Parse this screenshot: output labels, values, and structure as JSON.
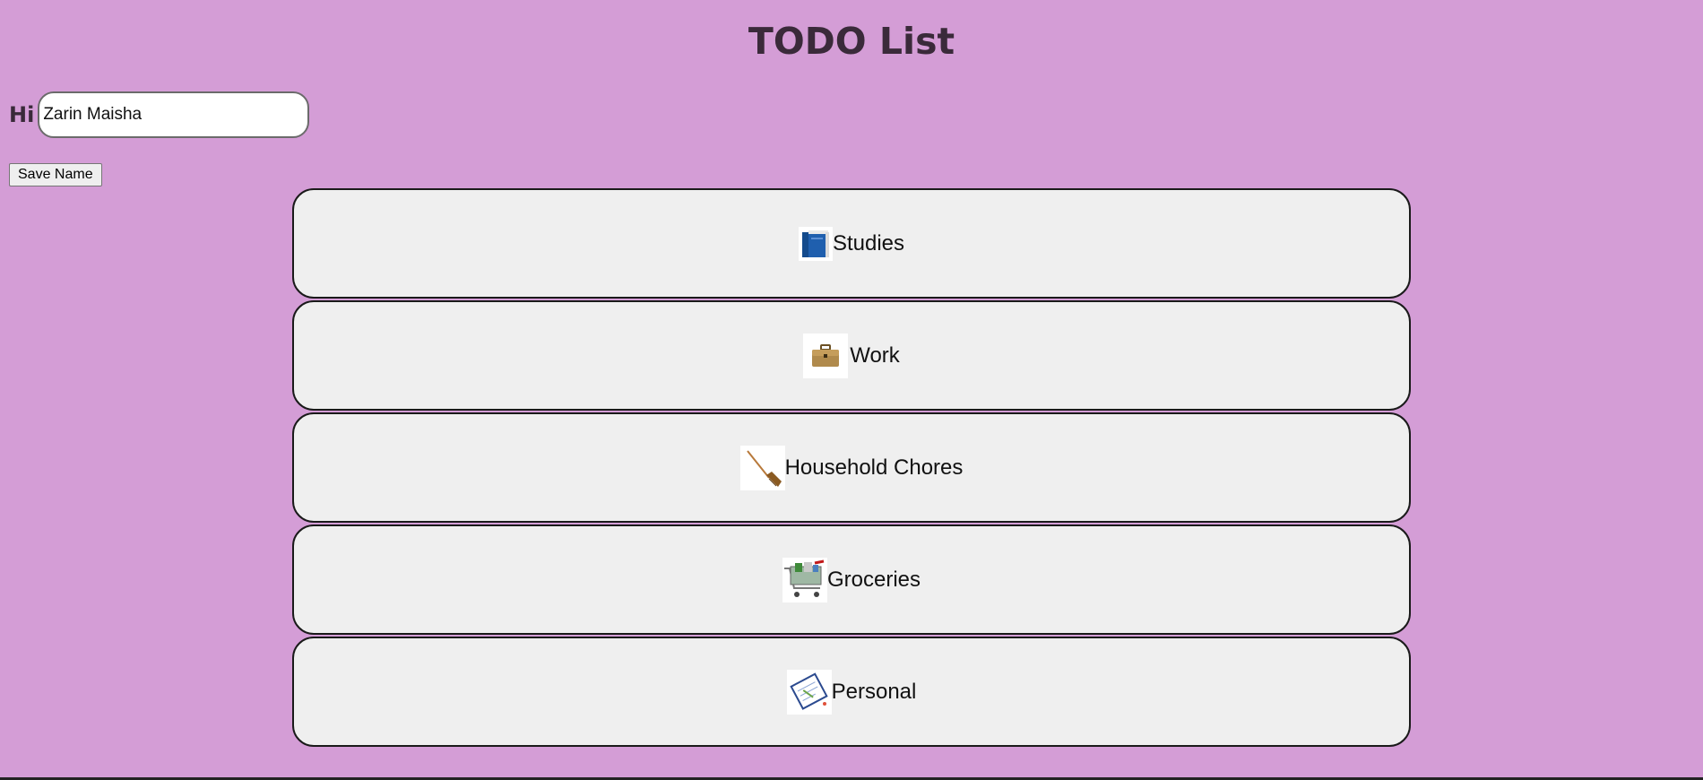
{
  "header": {
    "title": "TODO List"
  },
  "greeting": {
    "label": "Hi",
    "name_value": "Zarin Maisha",
    "save_label": "Save Name"
  },
  "categories": [
    {
      "label": "Studies",
      "icon": "book-icon"
    },
    {
      "label": "Work",
      "icon": "briefcase-icon"
    },
    {
      "label": "Household Chores",
      "icon": "broom-icon"
    },
    {
      "label": "Groceries",
      "icon": "shopping-cart-icon"
    },
    {
      "label": "Personal",
      "icon": "notepad-icon"
    }
  ]
}
